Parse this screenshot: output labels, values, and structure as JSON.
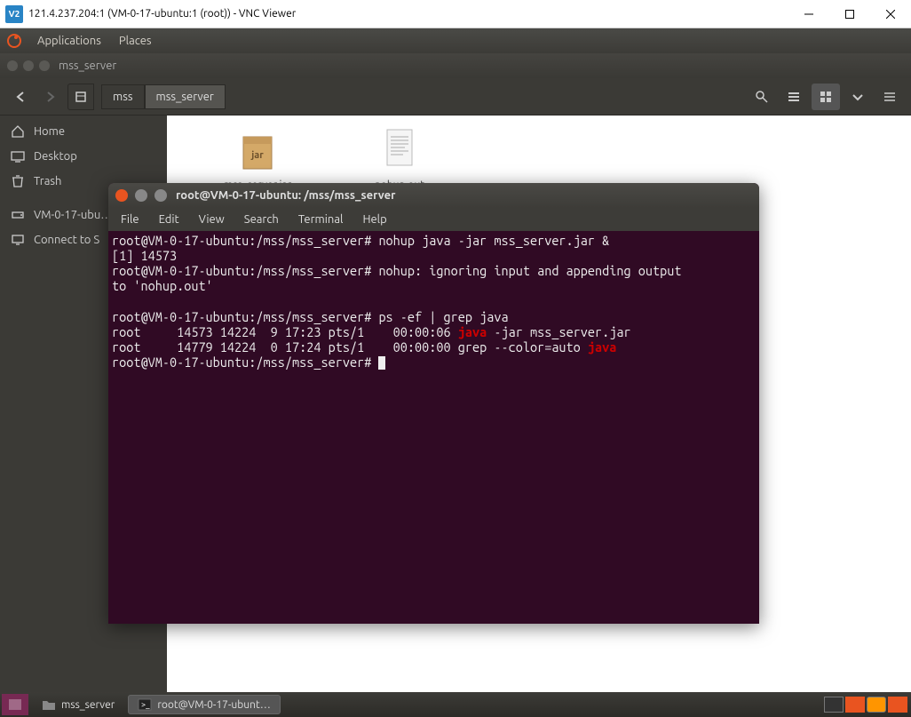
{
  "windows_title": "121.4.237.204:1 (VM-0-17-ubuntu:1 (root)) - VNC Viewer",
  "vnc_icon_text": "V2",
  "panel": {
    "applications": "Applications",
    "places": "Places"
  },
  "fm": {
    "title": "mss_server",
    "path": [
      "mss",
      "mss_server"
    ],
    "sidebar": {
      "home": "Home",
      "desktop": "Desktop",
      "trash": "Trash",
      "vm": "VM-0-17-ubu…",
      "connect": "Connect to S"
    },
    "files": {
      "jar": "mss_server.jar",
      "nohup": "nohup.out"
    }
  },
  "terminal": {
    "title": "root@VM-0-17-ubuntu: /mss/mss_server",
    "menus": {
      "file": "File",
      "edit": "Edit",
      "view": "View",
      "search": "Search",
      "terminal": "Terminal",
      "help": "Help"
    },
    "lines": {
      "l1a": "root@VM-0-17-ubuntu:/mss/mss_server# nohup java -jar mss_server.jar &",
      "l2": "[1] 14573",
      "l3": "root@VM-0-17-ubuntu:/mss/mss_server# nohup: ignoring input and appending output ",
      "l4": "to 'nohup.out'",
      "l5": "",
      "l6": "root@VM-0-17-ubuntu:/mss/mss_server# ps -ef | grep java",
      "l7a": "root     14573 14224  9 17:23 pts/1    00:00:06 ",
      "l7b": "java",
      "l7c": " -jar mss_server.jar",
      "l8a": "root     14779 14224  0 17:24 pts/1    00:00:00 grep --color=auto ",
      "l8b": "java",
      "l9": "root@VM-0-17-ubuntu:/mss/mss_server# "
    }
  },
  "taskbar": {
    "fm_task": "mss_server",
    "term_task": "root@VM-0-17-ubunt…"
  }
}
